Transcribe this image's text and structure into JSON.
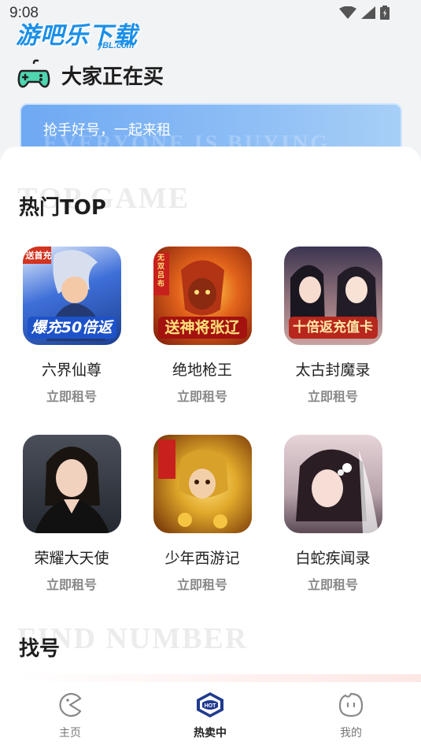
{
  "status": {
    "time": "9:08"
  },
  "watermark": {
    "cn": "游吧乐下载",
    "en": "yBL.com"
  },
  "header": {
    "title": "大家正在买"
  },
  "banner": {
    "text": "抢手好号，一起来租",
    "bg_text": "EVERYONE IS BUYING"
  },
  "hot": {
    "title": "热门TOP",
    "bg_text": "TOP GAME",
    "games": [
      {
        "name": "六界仙尊",
        "action": "立即租号",
        "badge": "爆充50倍返",
        "tag": "送首充",
        "colors": [
          "#1c3f8f",
          "#3e6fd8"
        ]
      },
      {
        "name": "绝地枪王",
        "action": "立即租号",
        "badge": "送神将张辽",
        "tag": "无双吕布",
        "colors": [
          "#7a1a0a",
          "#e2631b"
        ]
      },
      {
        "name": "太古封魔录",
        "action": "立即租号",
        "badge": "十倍返充值卡",
        "tag": "",
        "colors": [
          "#3b3550",
          "#c9a3a0"
        ]
      },
      {
        "name": "荣耀大天使",
        "action": "立即租号",
        "badge": "",
        "tag": "",
        "colors": [
          "#24282f",
          "#7a8090"
        ]
      },
      {
        "name": "少年西游记",
        "action": "立即租号",
        "badge": "",
        "tag": "",
        "colors": [
          "#6b2a05",
          "#e0a82a"
        ]
      },
      {
        "name": "白蛇疾闻录",
        "action": "立即租号",
        "badge": "",
        "tag": "",
        "colors": [
          "#5b4a55",
          "#e6d4d8"
        ]
      }
    ]
  },
  "find": {
    "title": "找号",
    "bg_text": "FIND NUMBER"
  },
  "tabbar": {
    "items": [
      {
        "label": "主页",
        "icon": "home-icon",
        "active": false
      },
      {
        "label": "热卖中",
        "icon": "hot-icon",
        "active": true
      },
      {
        "label": "我的",
        "icon": "profile-icon",
        "active": false
      }
    ]
  }
}
